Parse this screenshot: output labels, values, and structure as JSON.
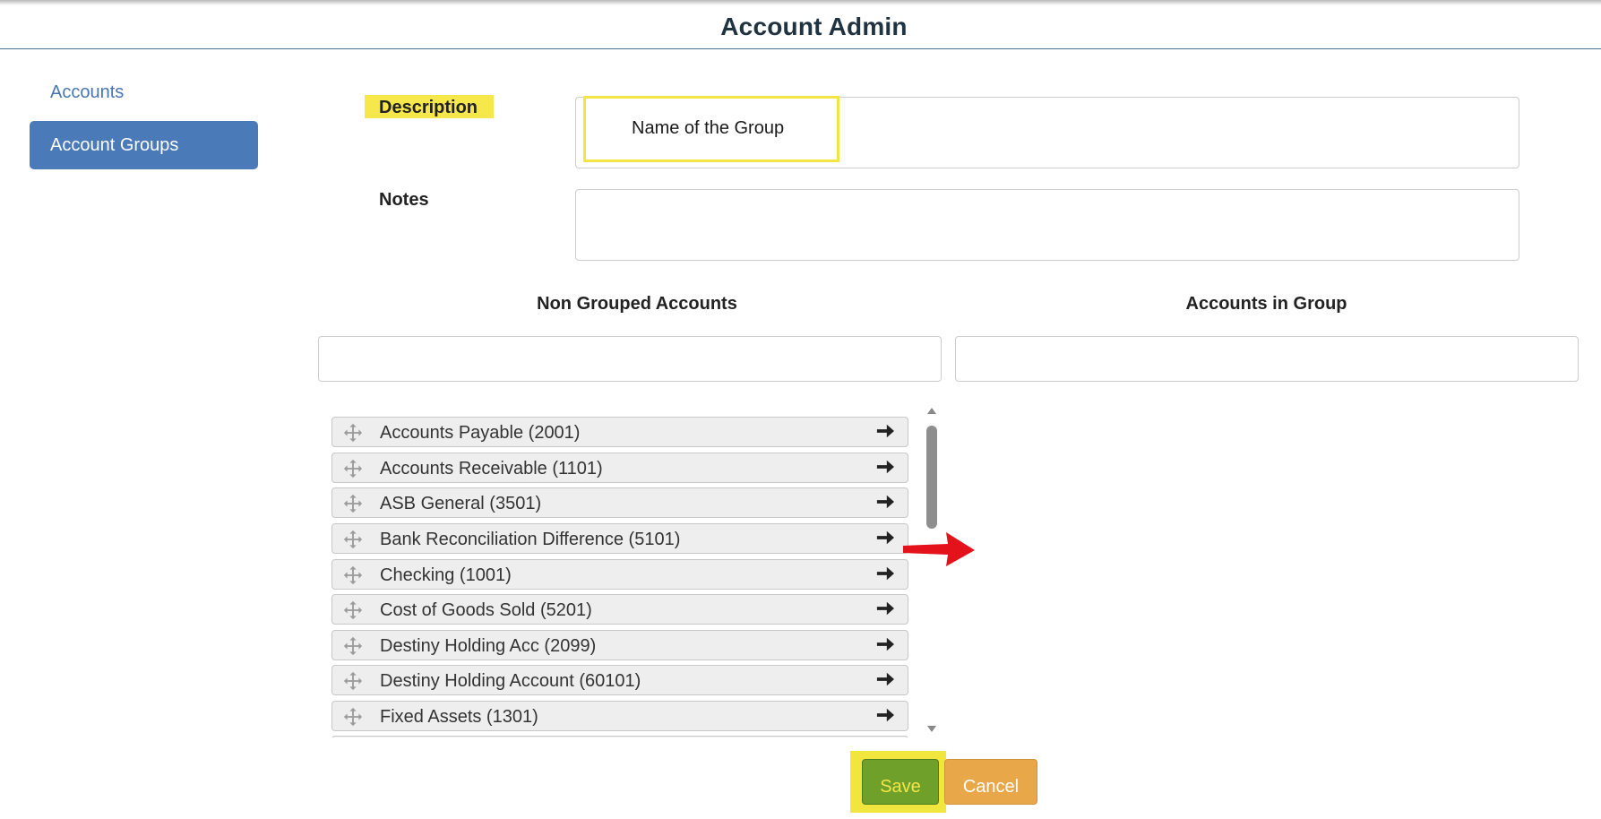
{
  "header": {
    "title": "Account Admin"
  },
  "sidebar": {
    "items": [
      {
        "label": "Accounts",
        "active": false
      },
      {
        "label": "Account Groups",
        "active": true
      }
    ]
  },
  "form": {
    "description_label": "Description",
    "description_value": "Name of the Group",
    "notes_label": "Notes",
    "notes_value": ""
  },
  "lists": {
    "left_header": "Non Grouped Accounts",
    "right_header": "Accounts in Group",
    "left_filter_value": "",
    "right_filter_value": "",
    "non_grouped": [
      "Accounts Payable (2001)",
      "Accounts Receivable (1101)",
      "ASB General (3501)",
      "Bank Reconciliation Difference (5101)",
      "Checking (1001)",
      "Cost of Goods Sold (5201)",
      "Destiny Holding Acc (2099)",
      "Destiny Holding Account (60101)",
      "Fixed Assets (1301)"
    ],
    "in_group": []
  },
  "buttons": {
    "save": "Save",
    "cancel": "Cancel"
  },
  "colors": {
    "accent": "#4b7ab9",
    "highlight": "#f3e642",
    "save": "#6ea02a",
    "cancel": "#e8a849",
    "annotation_arrow": "#e3121b"
  },
  "icons": {
    "item_handle": "move-icon",
    "item_action": "arrow-right-icon",
    "annotation": "red-arrow-icon"
  }
}
